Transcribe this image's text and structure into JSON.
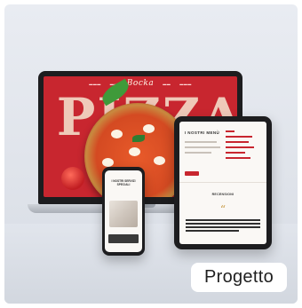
{
  "card": {
    "badge_label": "Progetto",
    "accent_color": "#c8262f"
  },
  "laptop_site": {
    "logo": "Bocka",
    "headline": "PIZZA"
  },
  "tablet_site": {
    "heading": "I NOSTRI MENÙ",
    "subheading": "RECENSIONI",
    "quote_mark": "“"
  },
  "phone_site": {
    "heading": "I NOSTRI SERVIZI SPECIALI"
  }
}
